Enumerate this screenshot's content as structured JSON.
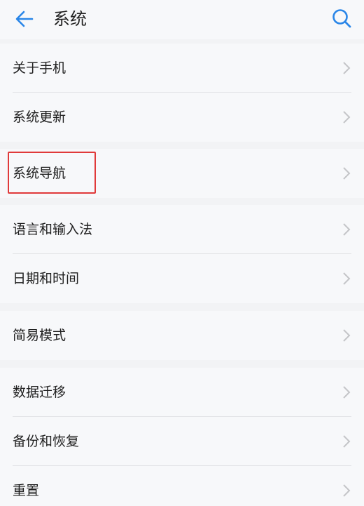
{
  "header": {
    "title": "系统",
    "back_icon": "arrow-left-icon",
    "search_icon": "search-icon",
    "accent_color": "#2a86e8"
  },
  "groups": [
    {
      "items": [
        {
          "label": "关于手机"
        },
        {
          "label": "系统更新"
        }
      ]
    },
    {
      "items": [
        {
          "label": "系统导航"
        }
      ]
    },
    {
      "items": [
        {
          "label": "语言和输入法"
        },
        {
          "label": "日期和时间"
        }
      ]
    },
    {
      "items": [
        {
          "label": "简易模式"
        }
      ]
    },
    {
      "items": [
        {
          "label": "数据迁移"
        },
        {
          "label": "备份和恢复"
        },
        {
          "label": "重置"
        }
      ]
    }
  ],
  "highlight": {
    "target": "系统导航",
    "color": "#e03a3a"
  }
}
